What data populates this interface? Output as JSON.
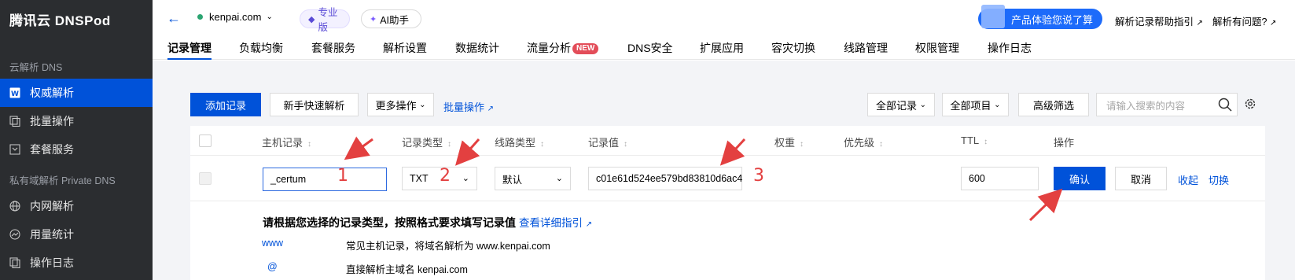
{
  "sidebar": {
    "brand": "腾讯云 DNSPod",
    "group1": "云解析 DNS",
    "items1": [
      "权威解析",
      "批量操作",
      "套餐服务"
    ],
    "group2": "私有域解析 Private DNS",
    "items2": [
      "内网解析",
      "用量统计",
      "操作日志"
    ]
  },
  "topbar": {
    "domain": "kenpai.com",
    "pro": "专业版",
    "ai": "AI助手",
    "promo": "产品体验您说了算",
    "help_link": "解析记录帮助指引",
    "question": "解析有问题?"
  },
  "tabs": [
    "记录管理",
    "负载均衡",
    "套餐服务",
    "解析设置",
    "数据统计",
    "流量分析",
    "DNS安全",
    "扩展应用",
    "容灾切换",
    "线路管理",
    "权限管理",
    "操作日志"
  ],
  "new_badge": "NEW",
  "toolbar": {
    "add": "添加记录",
    "quick": "新手快速解析",
    "more": "更多操作",
    "batch": "批量操作",
    "all_records": "全部记录",
    "all_items": "全部项目",
    "adv_filter": "高级筛选",
    "search_placeholder": "请输入搜索的内容"
  },
  "columns": [
    "主机记录",
    "记录类型",
    "线路类型",
    "记录值",
    "权重",
    "优先级",
    "TTL",
    "操作"
  ],
  "edit_row": {
    "host": "_certum",
    "type": "TXT",
    "line": "默认",
    "value": "c01e61d524ee579bd83810d6ac4",
    "ttl": "600",
    "confirm": "确认",
    "cancel": "取消",
    "collapse": "收起",
    "switch": "切换"
  },
  "hint": {
    "text": "请根据您选择的记录类型，按照格式要求填写记录值",
    "link": "查看详细指引"
  },
  "examples": [
    {
      "key": "www",
      "desc": "常见主机记录，将域名解析为 www.kenpai.com"
    },
    {
      "key": "@",
      "desc": "直接解析主域名 kenpai.com"
    }
  ],
  "annotations": [
    "1",
    "2",
    "3"
  ],
  "colors": {
    "primary": "#0052d9",
    "sidebar": "#2b2d30",
    "annotation": "#e34040"
  }
}
